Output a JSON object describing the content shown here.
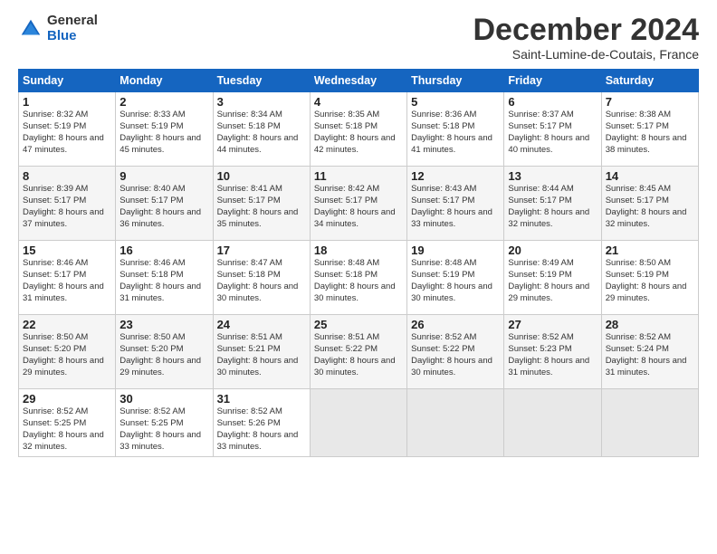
{
  "logo": {
    "general": "General",
    "blue": "Blue"
  },
  "header": {
    "month": "December 2024",
    "location": "Saint-Lumine-de-Coutais, France"
  },
  "weekdays": [
    "Sunday",
    "Monday",
    "Tuesday",
    "Wednesday",
    "Thursday",
    "Friday",
    "Saturday"
  ],
  "weeks": [
    [
      {
        "day": "1",
        "sunrise": "Sunrise: 8:32 AM",
        "sunset": "Sunset: 5:19 PM",
        "daylight": "Daylight: 8 hours and 47 minutes."
      },
      {
        "day": "2",
        "sunrise": "Sunrise: 8:33 AM",
        "sunset": "Sunset: 5:19 PM",
        "daylight": "Daylight: 8 hours and 45 minutes."
      },
      {
        "day": "3",
        "sunrise": "Sunrise: 8:34 AM",
        "sunset": "Sunset: 5:18 PM",
        "daylight": "Daylight: 8 hours and 44 minutes."
      },
      {
        "day": "4",
        "sunrise": "Sunrise: 8:35 AM",
        "sunset": "Sunset: 5:18 PM",
        "daylight": "Daylight: 8 hours and 42 minutes."
      },
      {
        "day": "5",
        "sunrise": "Sunrise: 8:36 AM",
        "sunset": "Sunset: 5:18 PM",
        "daylight": "Daylight: 8 hours and 41 minutes."
      },
      {
        "day": "6",
        "sunrise": "Sunrise: 8:37 AM",
        "sunset": "Sunset: 5:17 PM",
        "daylight": "Daylight: 8 hours and 40 minutes."
      },
      {
        "day": "7",
        "sunrise": "Sunrise: 8:38 AM",
        "sunset": "Sunset: 5:17 PM",
        "daylight": "Daylight: 8 hours and 38 minutes."
      }
    ],
    [
      {
        "day": "8",
        "sunrise": "Sunrise: 8:39 AM",
        "sunset": "Sunset: 5:17 PM",
        "daylight": "Daylight: 8 hours and 37 minutes."
      },
      {
        "day": "9",
        "sunrise": "Sunrise: 8:40 AM",
        "sunset": "Sunset: 5:17 PM",
        "daylight": "Daylight: 8 hours and 36 minutes."
      },
      {
        "day": "10",
        "sunrise": "Sunrise: 8:41 AM",
        "sunset": "Sunset: 5:17 PM",
        "daylight": "Daylight: 8 hours and 35 minutes."
      },
      {
        "day": "11",
        "sunrise": "Sunrise: 8:42 AM",
        "sunset": "Sunset: 5:17 PM",
        "daylight": "Daylight: 8 hours and 34 minutes."
      },
      {
        "day": "12",
        "sunrise": "Sunrise: 8:43 AM",
        "sunset": "Sunset: 5:17 PM",
        "daylight": "Daylight: 8 hours and 33 minutes."
      },
      {
        "day": "13",
        "sunrise": "Sunrise: 8:44 AM",
        "sunset": "Sunset: 5:17 PM",
        "daylight": "Daylight: 8 hours and 32 minutes."
      },
      {
        "day": "14",
        "sunrise": "Sunrise: 8:45 AM",
        "sunset": "Sunset: 5:17 PM",
        "daylight": "Daylight: 8 hours and 32 minutes."
      }
    ],
    [
      {
        "day": "15",
        "sunrise": "Sunrise: 8:46 AM",
        "sunset": "Sunset: 5:17 PM",
        "daylight": "Daylight: 8 hours and 31 minutes."
      },
      {
        "day": "16",
        "sunrise": "Sunrise: 8:46 AM",
        "sunset": "Sunset: 5:18 PM",
        "daylight": "Daylight: 8 hours and 31 minutes."
      },
      {
        "day": "17",
        "sunrise": "Sunrise: 8:47 AM",
        "sunset": "Sunset: 5:18 PM",
        "daylight": "Daylight: 8 hours and 30 minutes."
      },
      {
        "day": "18",
        "sunrise": "Sunrise: 8:48 AM",
        "sunset": "Sunset: 5:18 PM",
        "daylight": "Daylight: 8 hours and 30 minutes."
      },
      {
        "day": "19",
        "sunrise": "Sunrise: 8:48 AM",
        "sunset": "Sunset: 5:19 PM",
        "daylight": "Daylight: 8 hours and 30 minutes."
      },
      {
        "day": "20",
        "sunrise": "Sunrise: 8:49 AM",
        "sunset": "Sunset: 5:19 PM",
        "daylight": "Daylight: 8 hours and 29 minutes."
      },
      {
        "day": "21",
        "sunrise": "Sunrise: 8:50 AM",
        "sunset": "Sunset: 5:19 PM",
        "daylight": "Daylight: 8 hours and 29 minutes."
      }
    ],
    [
      {
        "day": "22",
        "sunrise": "Sunrise: 8:50 AM",
        "sunset": "Sunset: 5:20 PM",
        "daylight": "Daylight: 8 hours and 29 minutes."
      },
      {
        "day": "23",
        "sunrise": "Sunrise: 8:50 AM",
        "sunset": "Sunset: 5:20 PM",
        "daylight": "Daylight: 8 hours and 29 minutes."
      },
      {
        "day": "24",
        "sunrise": "Sunrise: 8:51 AM",
        "sunset": "Sunset: 5:21 PM",
        "daylight": "Daylight: 8 hours and 30 minutes."
      },
      {
        "day": "25",
        "sunrise": "Sunrise: 8:51 AM",
        "sunset": "Sunset: 5:22 PM",
        "daylight": "Daylight: 8 hours and 30 minutes."
      },
      {
        "day": "26",
        "sunrise": "Sunrise: 8:52 AM",
        "sunset": "Sunset: 5:22 PM",
        "daylight": "Daylight: 8 hours and 30 minutes."
      },
      {
        "day": "27",
        "sunrise": "Sunrise: 8:52 AM",
        "sunset": "Sunset: 5:23 PM",
        "daylight": "Daylight: 8 hours and 31 minutes."
      },
      {
        "day": "28",
        "sunrise": "Sunrise: 8:52 AM",
        "sunset": "Sunset: 5:24 PM",
        "daylight": "Daylight: 8 hours and 31 minutes."
      }
    ],
    [
      {
        "day": "29",
        "sunrise": "Sunrise: 8:52 AM",
        "sunset": "Sunset: 5:25 PM",
        "daylight": "Daylight: 8 hours and 32 minutes."
      },
      {
        "day": "30",
        "sunrise": "Sunrise: 8:52 AM",
        "sunset": "Sunset: 5:25 PM",
        "daylight": "Daylight: 8 hours and 33 minutes."
      },
      {
        "day": "31",
        "sunrise": "Sunrise: 8:52 AM",
        "sunset": "Sunset: 5:26 PM",
        "daylight": "Daylight: 8 hours and 33 minutes."
      },
      null,
      null,
      null,
      null
    ]
  ]
}
